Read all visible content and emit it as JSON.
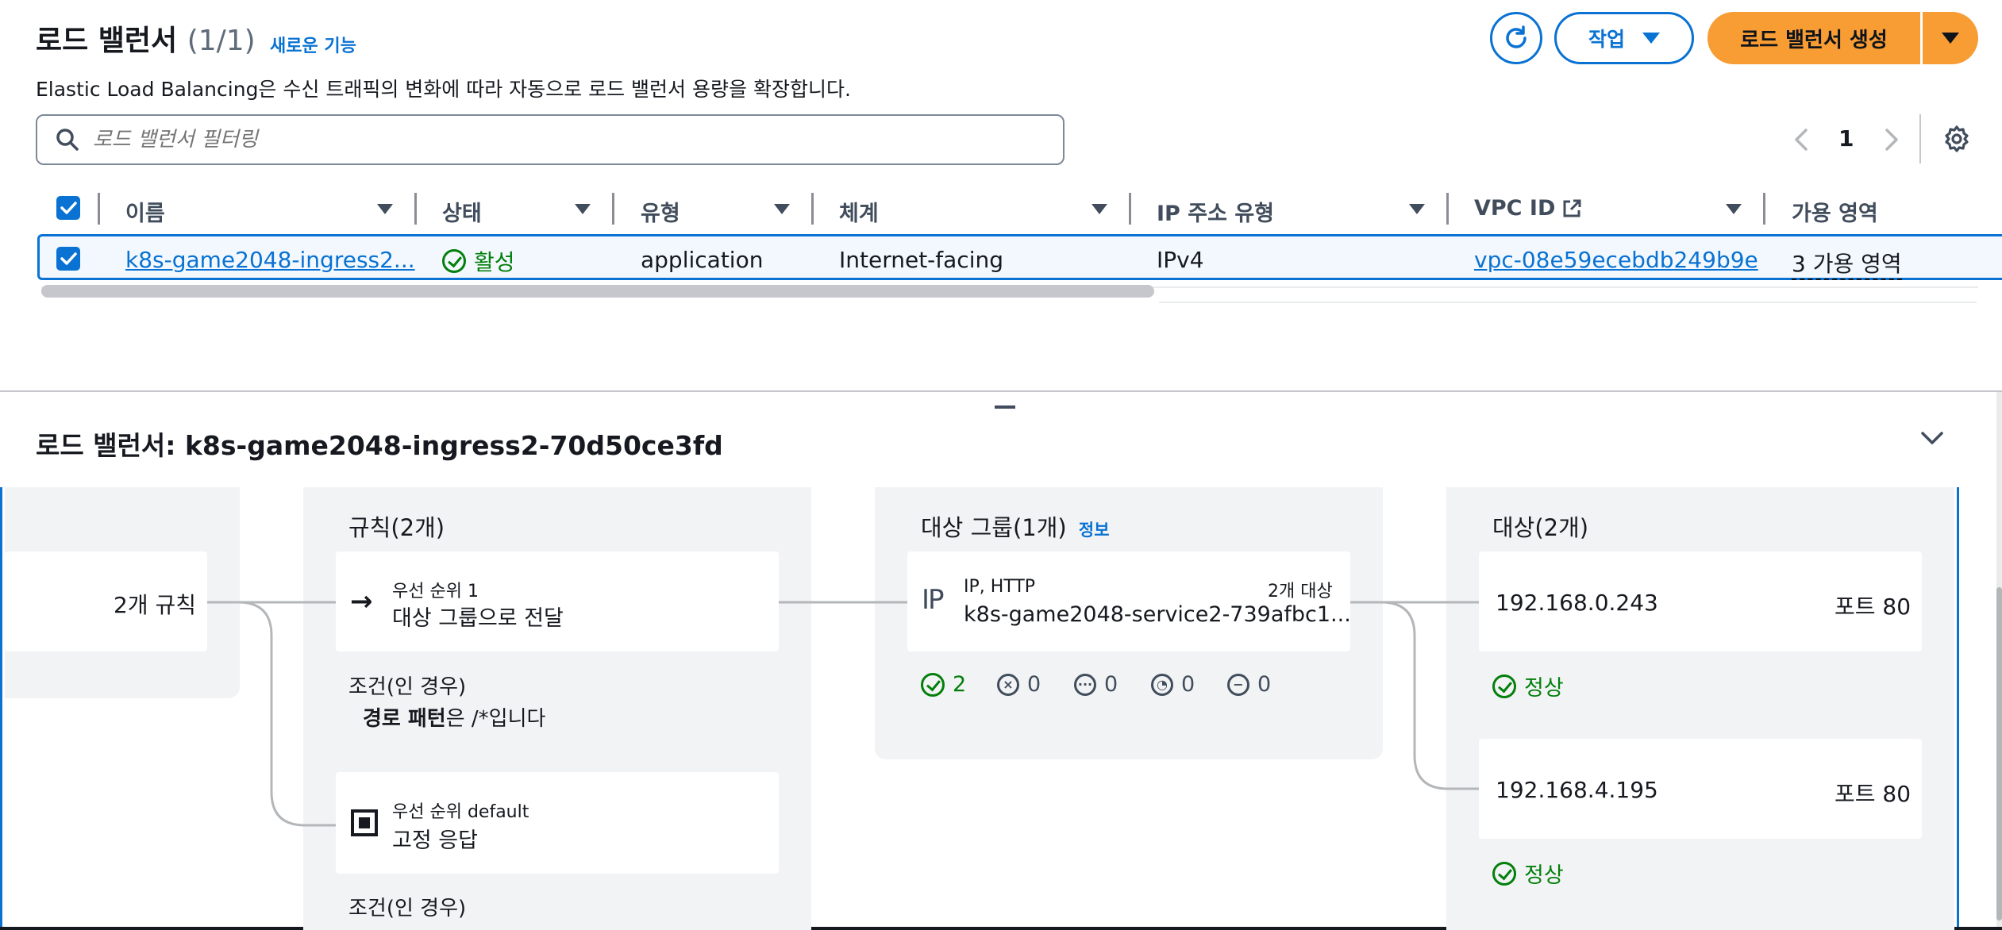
{
  "header": {
    "title": "로드 밸런서",
    "count": "(1/1)",
    "new_feature": "새로운 기능",
    "description": "Elastic Load Balancing은 수신 트래픽의 변화에 따라 자동으로 로드 밸런서 용량을 확장합니다.",
    "actions_label": "작업",
    "create_label": "로드 밸런서 생성"
  },
  "filter": {
    "placeholder": "로드 밸런서 필터링"
  },
  "pagination": {
    "page": "1"
  },
  "table": {
    "columns": [
      "이름",
      "상태",
      "유형",
      "체계",
      "IP 주소 유형",
      "VPC ID",
      "가용 영역"
    ],
    "rows": [
      {
        "name": "k8s-game2048-ingress2...",
        "status": "활성",
        "type": "application",
        "scheme": "Internet-facing",
        "ip_type": "IPv4",
        "vpc": "vpc-08e59ecebdb249b9e",
        "az": "3 가용 영역"
      }
    ]
  },
  "detail": {
    "title": "로드 밸런서: k8s-game2048-ingress2-70d50ce3fd",
    "listener": {
      "rules_count": "2개 규칙"
    },
    "rules": {
      "title": "규칙(2개)",
      "items": [
        {
          "priority": "우선 순위 1",
          "action": "대상 그룹으로 전달",
          "cond_title": "조건(인 경우)",
          "cond_bold": "경로 패턴",
          "cond_rest": "은 /*입니다"
        },
        {
          "priority": "우선 순위 default",
          "action": "고정 응답",
          "cond_title": "조건(인 경우)"
        }
      ]
    },
    "target_groups": {
      "title": "대상 그룹(1개)",
      "info": "정보",
      "group": {
        "protocol": "IP, HTTP",
        "targets_count": "2개 대상",
        "name": "k8s-game2048-service2-739afbc1...",
        "stats": {
          "healthy": "2",
          "unhealthy": "0",
          "unused": "0",
          "draining": "0",
          "unavailable": "0"
        }
      }
    },
    "targets": {
      "title": "대상(2개)",
      "items": [
        {
          "ip": "192.168.0.243",
          "port": "포트 80",
          "health": "정상"
        },
        {
          "ip": "192.168.4.195",
          "port": "포트 80",
          "health": "정상"
        }
      ]
    }
  },
  "colors": {
    "accent": "#0972d3",
    "primary": "#f89c34",
    "success": "#037f0c"
  }
}
